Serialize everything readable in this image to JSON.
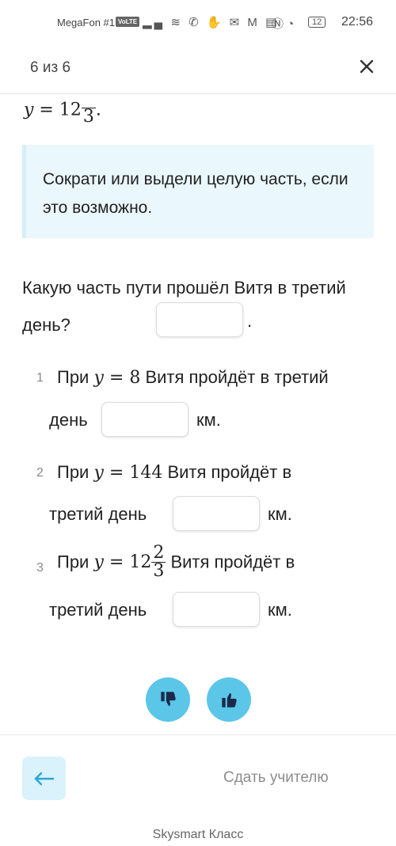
{
  "status_bar": {
    "carrier": "MegaFon #1",
    "volte": "VoLTE",
    "battery": "12",
    "time": "22:56"
  },
  "header": {
    "counter": "6 из 6",
    "close_icon": "close-icon"
  },
  "formula_top": {
    "var": "y",
    "eq": " = 12",
    "den": "3",
    "end": "."
  },
  "hint": {
    "text": "Сократи или выдели целую часть, если это возможно."
  },
  "question": {
    "text": "Какую часть пути прошёл Витя в третий день?",
    "answer_value": "",
    "end": "."
  },
  "items": [
    {
      "num": "1",
      "prefix": "При",
      "var": "y",
      "eq": " = 8",
      "text_a": "Витя пройдёт в третий",
      "text_b": "день",
      "unit": "км.",
      "value": ""
    },
    {
      "num": "2",
      "prefix": "При",
      "var": "y",
      "eq": " = 144",
      "text_a": "Витя пройдёт в",
      "text_b": "третий день",
      "unit": "км.",
      "value": ""
    },
    {
      "num": "3",
      "prefix": "При",
      "var": "y",
      "eq": " = 12",
      "frac_num": "2",
      "frac_den": "3",
      "text_a": "Витя пройдёт в",
      "text_b": "третий день",
      "unit": "км.",
      "value": ""
    }
  ],
  "reactions": {
    "dislike_icon": "thumbs-down-icon",
    "like_icon": "thumbs-up-icon"
  },
  "bottom": {
    "back_icon": "arrow-left-icon",
    "submit_label": "Сдать учителю",
    "footer": "Skysmart Класс"
  },
  "colors": {
    "accent": "#5bc6e8",
    "hint_bg": "#eaf7fc",
    "back_bg": "#d9f2fb"
  }
}
